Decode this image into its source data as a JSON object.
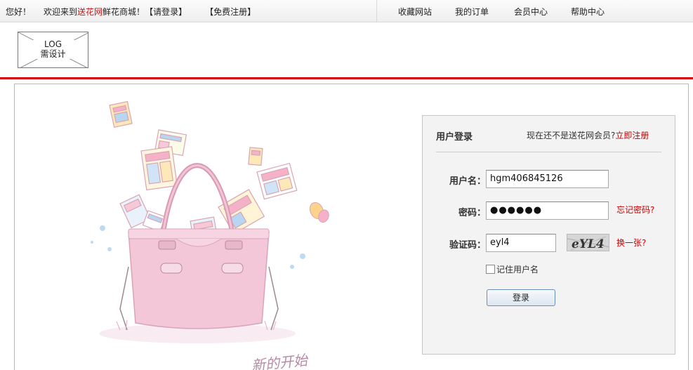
{
  "topbar": {
    "greeting": "您好！",
    "welcome_prefix": "欢迎来到",
    "site_name": "送花网",
    "welcome_suffix": "鲜花商城！",
    "login_link": "【请登录】",
    "register_link": "【免费注册】",
    "nav": [
      "收藏网站",
      "我的订单",
      "会员中心",
      "帮助中心"
    ]
  },
  "header": {
    "logo_line1": "LOG",
    "logo_line2": "需设计"
  },
  "illustration": {
    "signature": "新的开始"
  },
  "login": {
    "title": "用户登录",
    "not_member": "现在还不是送花网会员?",
    "register_now": "立即注册",
    "username_label": "用户名：",
    "username_value": "hgm406845126",
    "password_label": "密码：",
    "password_value": "●●●●●●",
    "forgot_password": "忘记密码?",
    "captcha_label": "验证码：",
    "captcha_value": "eyl4",
    "captcha_image_text": "eYL4",
    "change_captcha": "换一张?",
    "remember_label": "记住用户名",
    "submit_label": "登录"
  },
  "colors": {
    "accent_red": "#d40000",
    "link_red": "#cc0000",
    "panel_bg": "#f3f3f3",
    "bag_pink": "#f3c7d8"
  }
}
